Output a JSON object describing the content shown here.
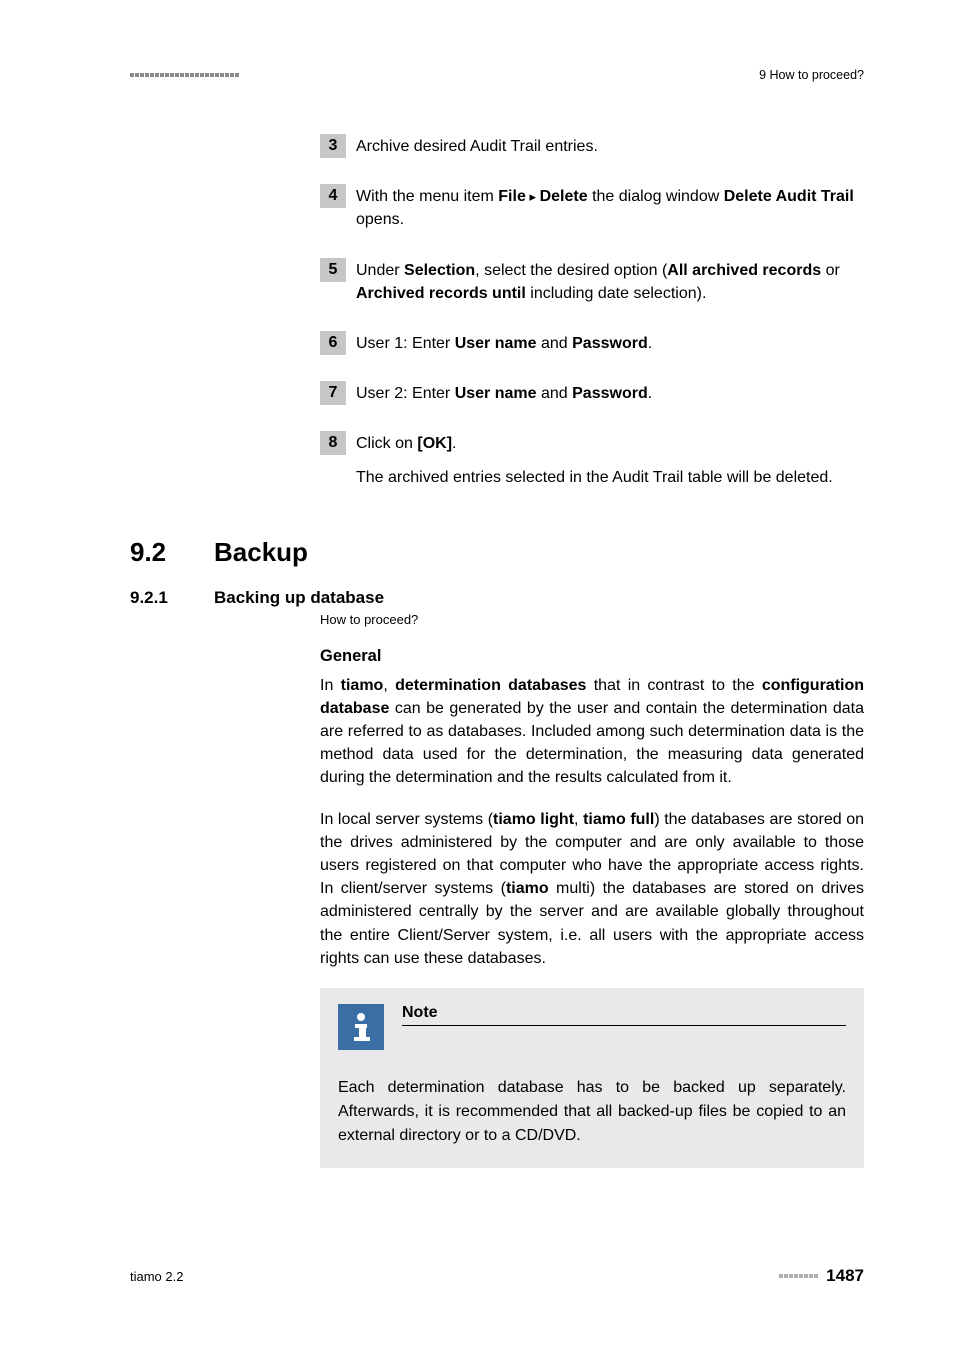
{
  "header": {
    "right": "9 How to proceed?"
  },
  "steps": {
    "s3": {
      "num": "3",
      "body": "Archive desired Audit Trail entries."
    },
    "s4": {
      "num": "4",
      "p1": "With the menu item ",
      "b1": "File",
      "sep": " ▸ ",
      "b2": "Delete",
      "p2": " the dialog window ",
      "b3": "Delete Audit Trail",
      "p3": " opens."
    },
    "s5": {
      "num": "5",
      "p1": "Under ",
      "b1": "Selection",
      "p2": ", select the desired option (",
      "b2": "All archived records",
      "p3": " or ",
      "b3": "Archived records until",
      "p4": " including date selection)."
    },
    "s6": {
      "num": "6",
      "p1": "User 1: Enter ",
      "b1": "User name",
      "p2": " and ",
      "b2": "Password",
      "p3": "."
    },
    "s7": {
      "num": "7",
      "p1": "User 2: Enter ",
      "b1": "User name",
      "p2": " and ",
      "b2": "Password",
      "p3": "."
    },
    "s8": {
      "num": "8",
      "p1": "Click on ",
      "b1": "[OK]",
      "p2": ".",
      "result": "The archived entries selected in the Audit Trail table will be deleted."
    }
  },
  "section": {
    "num": "9.2",
    "title": "Backup"
  },
  "subsection": {
    "num": "9.2.1",
    "title": "Backing up database",
    "breadcrumb": "How to proceed?"
  },
  "general": {
    "heading": "General",
    "p1a": "In ",
    "p1b1": "tiamo",
    "p1b": ", ",
    "p1b2": "determination databases",
    "p1c": " that in contrast to the ",
    "p1b3": "configuration database",
    "p1d": " can be generated by the user and contain the determination data are referred to as databases. Included among such determination data is the method data used for the determination, the measuring data generated during the determination and the results calculated from it.",
    "p2a": "In local server systems (",
    "p2b1": "tiamo light",
    "p2b": ", ",
    "p2b2": "tiamo full",
    "p2c": ") the databases are stored on the drives administered by the computer and are only available to those users registered on that computer who have the appropriate access rights. In client/server systems (",
    "p2b3": "tiamo",
    "p2d": " multi) the databases are stored on drives administered centrally by the server and are available globally throughout the entire Client/Server system, i.e. all users with the appropriate access rights can use these databases."
  },
  "note": {
    "title": "Note",
    "body": "Each determination database has to be backed up separately. Afterwards, it is recommended that all backed-up files be copied to an external directory or to a CD/DVD."
  },
  "footer": {
    "left": "tiamo 2.2",
    "page": "1487"
  }
}
